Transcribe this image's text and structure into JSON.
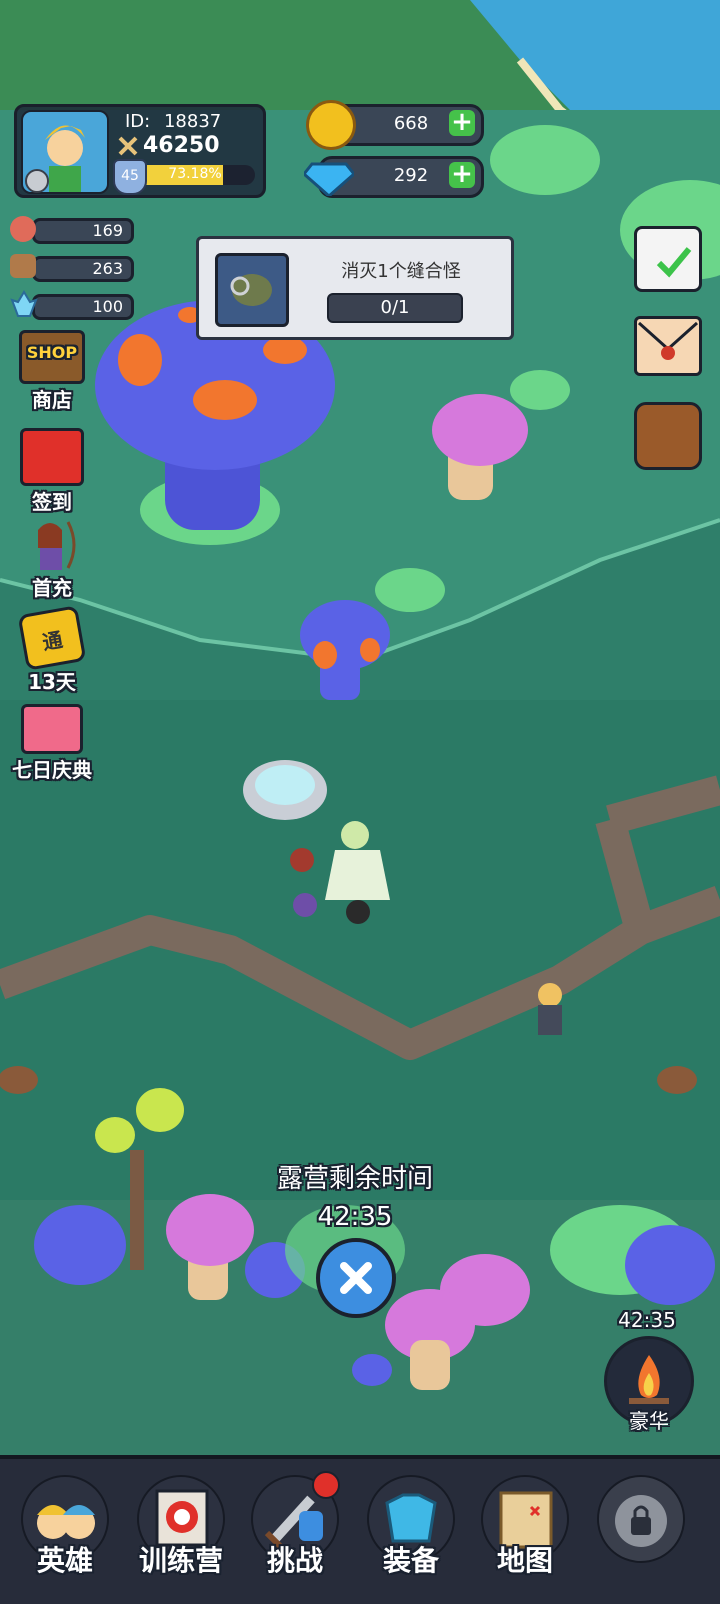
{
  "player": {
    "id_label": "ID:",
    "id": "18837",
    "power": "46250",
    "level": "45",
    "exp_percent": "73.18%",
    "exp_fraction": 0.7318
  },
  "currencies": {
    "gold": "668",
    "gems": "292"
  },
  "resources": [
    {
      "icon": "meat-icon",
      "value": "169"
    },
    {
      "icon": "wood-icon",
      "value": "263"
    },
    {
      "icon": "crystal-icon",
      "value": "100"
    }
  ],
  "quest": {
    "title": "消灭1个缝合怪",
    "progress": "0/1"
  },
  "left_menu": [
    {
      "icon": "shop-icon",
      "badge": "SHOP",
      "label": "商店"
    },
    {
      "icon": "gift-box-icon",
      "label": "签到"
    },
    {
      "icon": "archer-hero-icon",
      "label": "首充"
    },
    {
      "icon": "pass-icon",
      "badge": "通",
      "label": "13天"
    },
    {
      "icon": "gift-pack-icon",
      "label": "七日庆典"
    }
  ],
  "right_menu": [
    {
      "icon": "task-clipboard-icon"
    },
    {
      "icon": "mail-envelope-icon"
    },
    {
      "icon": "backpack-icon"
    }
  ],
  "camp": {
    "label": "露营剩余时间",
    "timer": "42:35",
    "close_icon": "close-icon"
  },
  "campfire": {
    "timer": "42:35",
    "label": "豪华"
  },
  "bottom_tabs": [
    {
      "icon": "heroes-icon",
      "label": "英雄"
    },
    {
      "icon": "target-icon",
      "label": "训练营"
    },
    {
      "icon": "sword-shield-icon",
      "label": "挑战",
      "badge": true
    },
    {
      "icon": "armor-icon",
      "label": "装备"
    },
    {
      "icon": "treasure-map-icon",
      "label": "地图"
    },
    {
      "icon": "locked-icon",
      "label": ""
    }
  ],
  "colors": {
    "grass": "#2f7f6a",
    "grass_light": "#3f9a7c",
    "path": "#7a6a5e",
    "water": "#3fa6d8",
    "exp_bar": "#f2d13c",
    "plus_green": "#45c24a"
  }
}
